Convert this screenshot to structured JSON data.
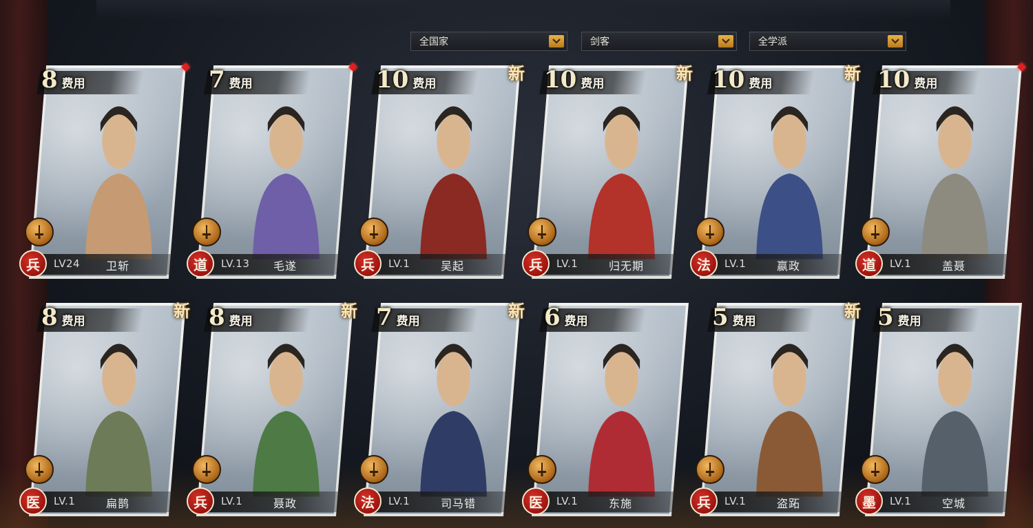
{
  "filters": [
    {
      "label": "全国家"
    },
    {
      "label": "剑客"
    },
    {
      "label": "全学派"
    }
  ],
  "cost_label": "费用",
  "new_label": "新",
  "cards": [
    {
      "cost": "8",
      "cls": "兵",
      "level": "LV24",
      "name": "卫斩",
      "is_new": false,
      "red_dot": true,
      "tint": "#c69a72"
    },
    {
      "cost": "7",
      "cls": "道",
      "level": "LV.13",
      "name": "毛遂",
      "is_new": false,
      "red_dot": true,
      "tint": "#6e5fa8"
    },
    {
      "cost": "10",
      "cls": "兵",
      "level": "LV.1",
      "name": "吴起",
      "is_new": true,
      "red_dot": false,
      "tint": "#8a2a22"
    },
    {
      "cost": "10",
      "cls": "兵",
      "level": "LV.1",
      "name": "归无期",
      "is_new": true,
      "red_dot": false,
      "tint": "#b3322a"
    },
    {
      "cost": "10",
      "cls": "法",
      "level": "LV.1",
      "name": "嬴政",
      "is_new": true,
      "red_dot": false,
      "tint": "#3c4f86"
    },
    {
      "cost": "10",
      "cls": "道",
      "level": "LV.1",
      "name": "盖聂",
      "is_new": false,
      "red_dot": true,
      "tint": "#8d8a80"
    },
    {
      "cost": "8",
      "cls": "医",
      "level": "LV.1",
      "name": "扁鹊",
      "is_new": true,
      "red_dot": false,
      "tint": "#6e7b58"
    },
    {
      "cost": "8",
      "cls": "兵",
      "level": "LV.1",
      "name": "聂政",
      "is_new": true,
      "red_dot": false,
      "tint": "#4d7a45"
    },
    {
      "cost": "7",
      "cls": "法",
      "level": "LV.1",
      "name": "司马错",
      "is_new": true,
      "red_dot": false,
      "tint": "#2f3d66"
    },
    {
      "cost": "6",
      "cls": "医",
      "level": "LV.1",
      "name": "东施",
      "is_new": false,
      "red_dot": false,
      "tint": "#b02c34"
    },
    {
      "cost": "5",
      "cls": "兵",
      "level": "LV.1",
      "name": "盗跖",
      "is_new": true,
      "red_dot": false,
      "tint": "#8a5a36"
    },
    {
      "cost": "5",
      "cls": "墨",
      "level": "LV.1",
      "name": "空城",
      "is_new": false,
      "red_dot": false,
      "tint": "#55606a"
    }
  ]
}
